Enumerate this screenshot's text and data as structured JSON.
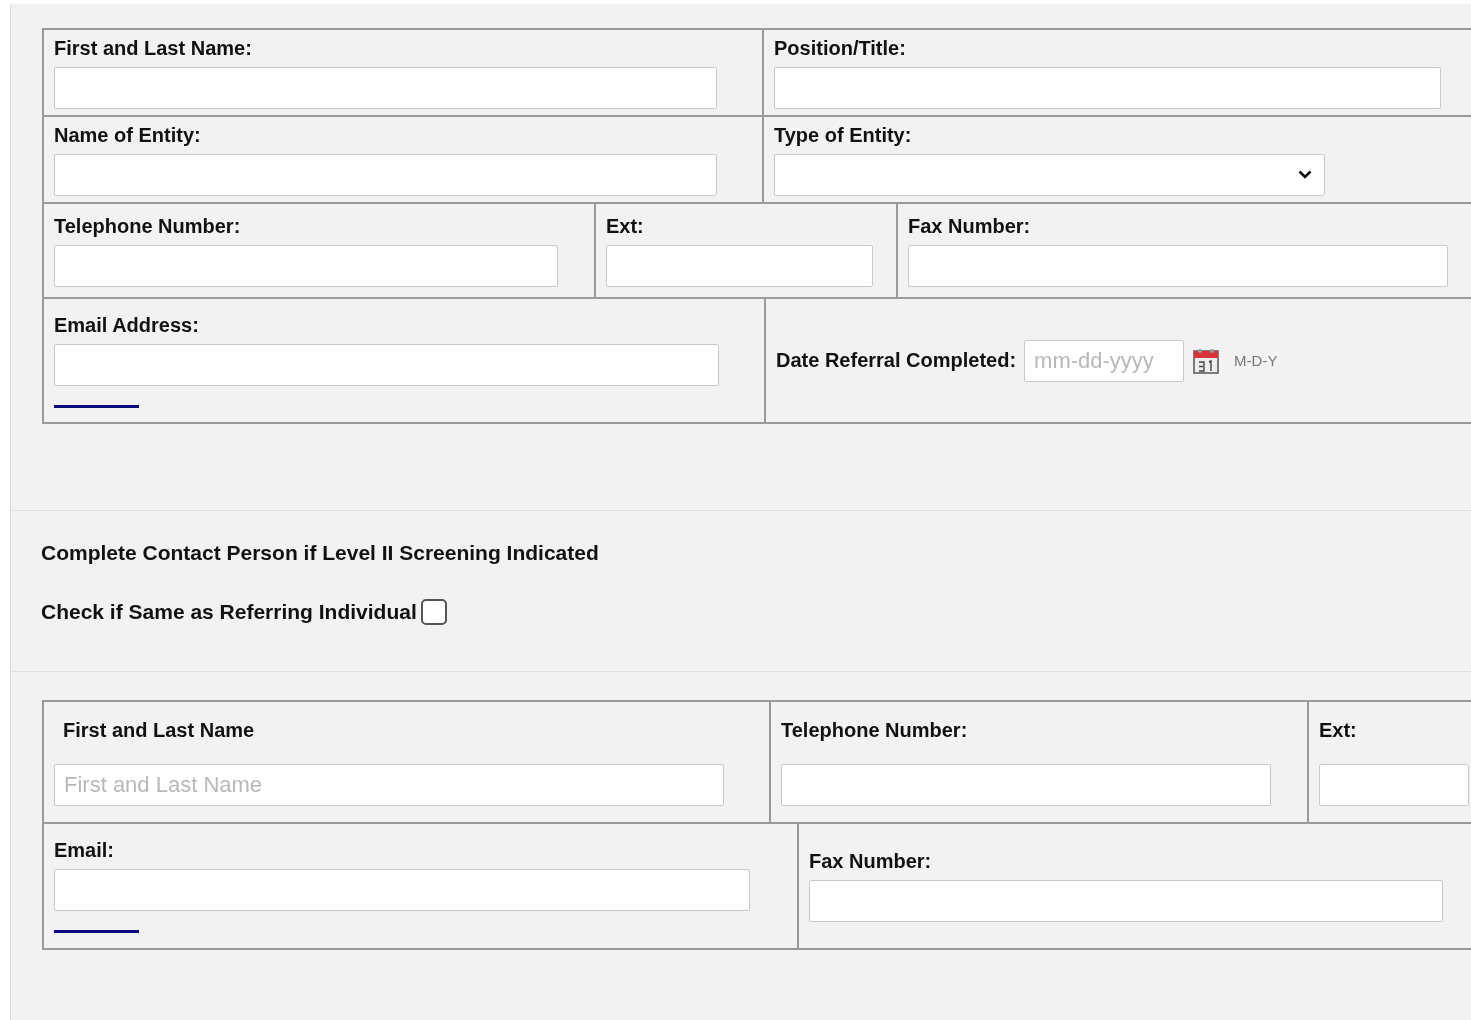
{
  "referring_table": {
    "rows": [
      {
        "cells": [
          {
            "label": "First and Last Name:",
            "kind": "text"
          },
          {
            "label": "Position/Title:",
            "kind": "text"
          }
        ]
      },
      {
        "cells": [
          {
            "label": "Name of Entity:",
            "kind": "text"
          },
          {
            "label": "Type of Entity:",
            "kind": "select"
          }
        ]
      },
      {
        "cells": [
          {
            "label": "Telephone Number:",
            "kind": "text"
          },
          {
            "label": "Ext:",
            "kind": "text"
          },
          {
            "label": "Fax Number:",
            "kind": "text"
          }
        ]
      },
      {
        "cells": [
          {
            "label": "Email Address:",
            "kind": "text",
            "underline": true
          },
          {
            "label": "Date Referral Completed:",
            "kind": "date",
            "placeholder": "mm-dd-yyyy",
            "hint": "M-D-Y"
          }
        ]
      }
    ]
  },
  "contact_section": {
    "heading": "Complete Contact Person if Level II Screening Indicated",
    "same_as_referring": {
      "label": "Check if Same as Referring Individual",
      "checked": false
    }
  },
  "contact_table": {
    "rows": [
      {
        "cells": [
          {
            "label": "First and Last Name",
            "kind": "text",
            "placeholder": "First and Last Name"
          },
          {
            "label": "Telephone Number:",
            "kind": "text"
          },
          {
            "label": "Ext:",
            "kind": "text"
          }
        ]
      },
      {
        "cells": [
          {
            "label": "Email:",
            "kind": "text",
            "underline": true
          },
          {
            "label": "Fax Number:",
            "kind": "text"
          }
        ]
      }
    ]
  }
}
